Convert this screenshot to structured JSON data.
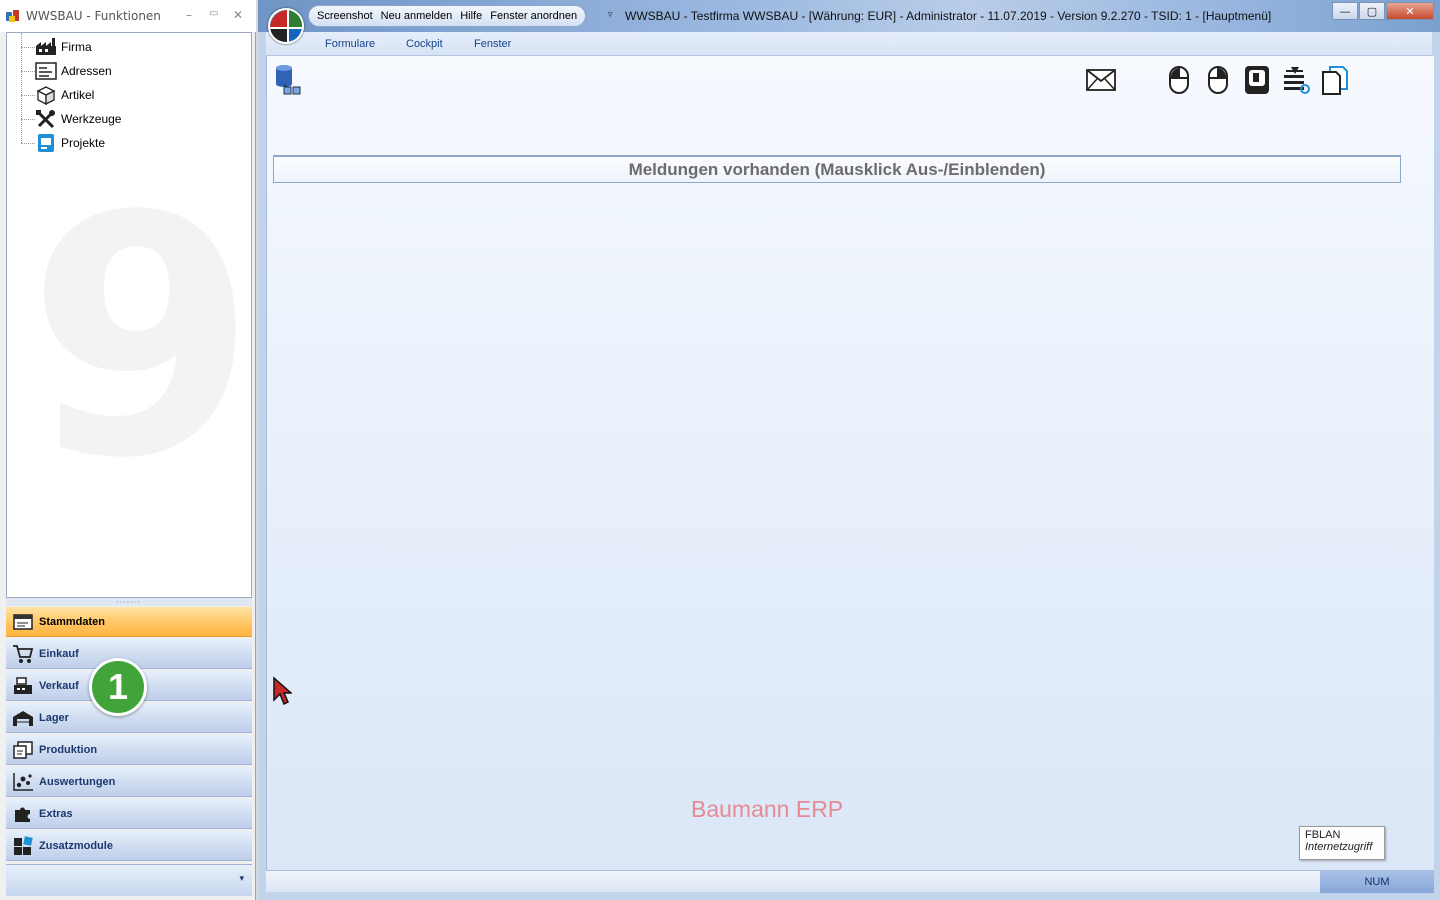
{
  "left_window": {
    "title": "WWSBAU - Funktionen",
    "controls": {
      "minimize": "–",
      "maximize": "▭",
      "close": "✕"
    },
    "tree": [
      {
        "label": "Firma",
        "icon": "factory-icon"
      },
      {
        "label": "Adressen",
        "icon": "address-card-icon"
      },
      {
        "label": "Artikel",
        "icon": "box-icon"
      },
      {
        "label": "Werkzeuge",
        "icon": "tools-icon"
      },
      {
        "label": "Projekte",
        "icon": "project-icon"
      }
    ],
    "navigation": [
      {
        "label": "Stammdaten",
        "icon": "master-data-icon",
        "active": true
      },
      {
        "label": "Einkauf",
        "icon": "shopping-cart-icon"
      },
      {
        "label": "Verkauf",
        "icon": "cash-register-icon"
      },
      {
        "label": "Lager",
        "icon": "warehouse-icon"
      },
      {
        "label": "Produktion",
        "icon": "production-icon"
      },
      {
        "label": "Auswertungen",
        "icon": "analytics-icon"
      },
      {
        "label": "Extras",
        "icon": "puzzle-icon"
      },
      {
        "label": "Zusatzmodule",
        "icon": "modules-icon"
      }
    ],
    "footer_chevron": "▾",
    "step_badge": "1"
  },
  "main_window": {
    "quick_access": [
      "Screenshot",
      "Neu anmelden",
      "Hilfe",
      "Fenster anordnen"
    ],
    "quick_access_arrow": "▿",
    "title": "WWSBAU - Testfirma WWSBAU - [Währung: EUR] - Administrator - 11.07.2019 - Version 9.2.270 - TSID: 1  - [Hauptmenü]",
    "controls": {
      "minimize": "—",
      "maximize": "▢",
      "close": "✕"
    },
    "menu": [
      "Formulare",
      "Cockpit",
      "Fenster"
    ],
    "toolbar": [
      "database-icon",
      "mail-icon",
      "mouse-left-icon",
      "mouse-right-icon",
      "keyboard-key-icon",
      "network-settings-icon",
      "document-copy-icon"
    ],
    "messages_bar": "Meldungen vorhanden  (Mausklick Aus-/Einblenden)",
    "brand": "Baumann ERP",
    "network_tooltip": {
      "line1": "FBLAN",
      "line2": "Internetzugriff"
    },
    "status_right": "NUM"
  },
  "colors": {
    "accent_orange": "#ffb340",
    "nav_blue": "#1a3a6e",
    "brand_pink": "#e78a93",
    "badge_green": "#41a43b"
  }
}
